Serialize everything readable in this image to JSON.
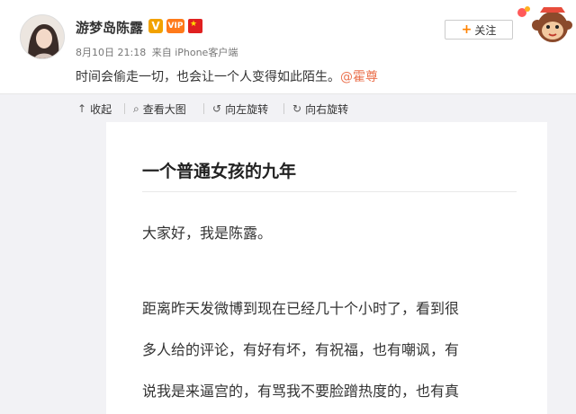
{
  "post": {
    "username": "游梦岛陈露",
    "badges": {
      "v": "V",
      "vip": "VIP"
    },
    "time": "8月10日 21:18",
    "source": "来自 iPhone客户端",
    "text": "时间会偷走一切，也会让一个人变得如此陌生。",
    "mention": "@霍尊",
    "follow_label": "关注"
  },
  "toolbar": {
    "collapse": "收起",
    "view_large": "查看大图",
    "rotate_left": "向左旋转",
    "rotate_right": "向右旋转"
  },
  "article": {
    "title": "一个普通女孩的九年",
    "lines": [
      "大家好，我是陈露。",
      "距离昨天发微博到现在已经几十个小时了，看到很",
      "多人给的评论，有好有坏，有祝福，也有嘲讽，有",
      "说我是来逼宫的，有骂我不要脸蹭热度的，也有真"
    ]
  },
  "colors": {
    "mention": "#eb7350",
    "follow_plus": "#ff8200",
    "toolbar_bg": "#f2f2f5"
  }
}
